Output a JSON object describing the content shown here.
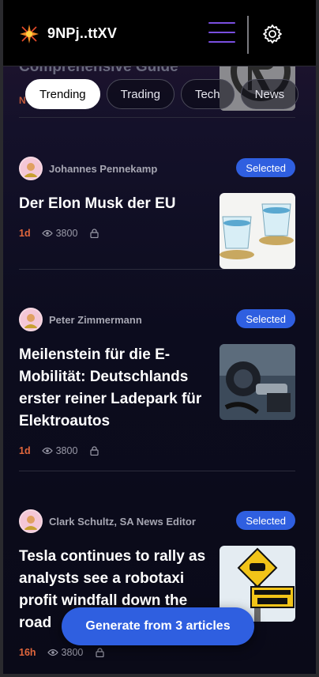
{
  "header": {
    "wallet_label": "9NPj..ttXV"
  },
  "partial_card": {
    "title": "Comprehensive Guide",
    "age": "N"
  },
  "tabs": [
    {
      "label": "Trending",
      "active": true
    },
    {
      "label": "Trading",
      "active": false
    },
    {
      "label": "Tech",
      "active": false
    },
    {
      "label": "News",
      "active": false
    }
  ],
  "articles": [
    {
      "author": "Johannes Pennekamp",
      "badge": "Selected",
      "title": "Der Elon Musk der EU",
      "age": "1d",
      "views": "3800",
      "thumb": "cups-on-coins"
    },
    {
      "author": "Peter Zimmermann",
      "badge": "Selected",
      "title": "Meilenstein für die E-Mobilität: Deutschlands erster reiner Ladepark für Elektroautos",
      "age": "1d",
      "views": "3800",
      "thumb": "ev-charging-plug"
    },
    {
      "author": "Clark Schultz, SA News Editor",
      "badge": "Selected",
      "title": "Tesla continues to rally as analysts see a robotaxi profit windfall down the road",
      "age": "16h",
      "views": "3800",
      "thumb": "self-driving-taxi-sign"
    }
  ],
  "generate_button": {
    "label": "Generate from 3 articles"
  },
  "colors": {
    "accent": "#2f5fe0",
    "age": "#e0663c",
    "menu": "#7a4fe0"
  }
}
